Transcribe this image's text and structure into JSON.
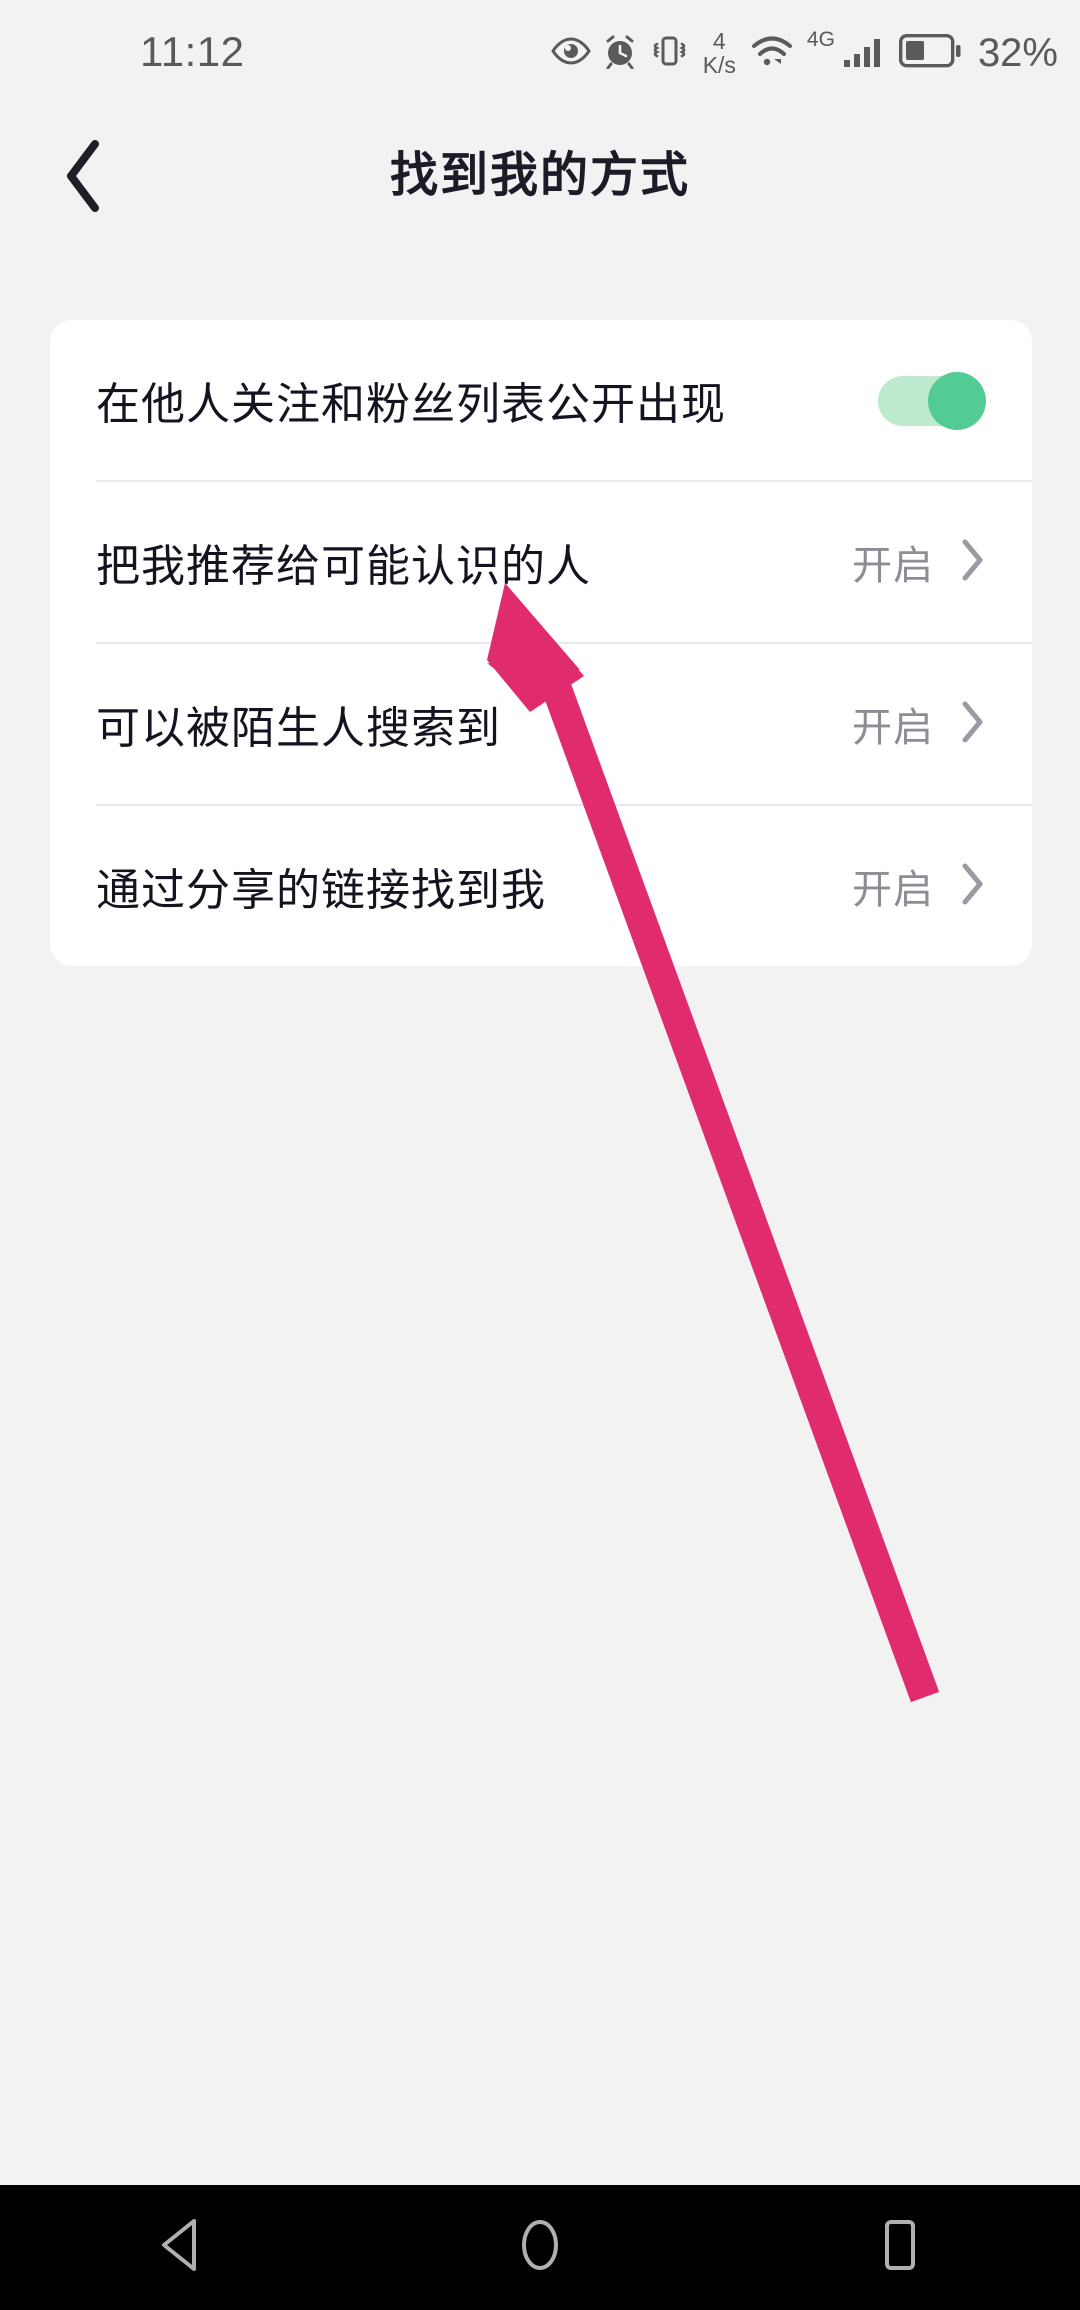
{
  "statusbar": {
    "time": "11:12",
    "network_speed_value": "4",
    "network_speed_unit": "K/s",
    "signal_gen": "4G",
    "battery_percent": "32%",
    "icons": [
      "eye-care-icon",
      "alarm-clock-icon",
      "vibrate-icon",
      "wifi-icon",
      "cellular-signal-icon",
      "battery-icon"
    ]
  },
  "header": {
    "title": "找到我的方式",
    "back_icon": "chevron-left-icon"
  },
  "settings": {
    "rows": [
      {
        "label": "在他人关注和粉丝列表公开出现",
        "control": "toggle",
        "toggle_on": true
      },
      {
        "label": "把我推荐给可能认识的人",
        "control": "value-chevron",
        "value": "开启"
      },
      {
        "label": "可以被陌生人搜索到",
        "control": "value-chevron",
        "value": "开启"
      },
      {
        "label": "通过分享的链接找到我",
        "control": "value-chevron",
        "value": "开启"
      }
    ]
  },
  "annotation": {
    "type": "arrow",
    "color": "#e02b6e",
    "points_to_row_index": 1
  },
  "navbar": {
    "back_label": "back-triangle-icon",
    "home_label": "home-circle-icon",
    "recents_label": "recents-square-icon"
  },
  "colors": {
    "background": "#f2f2f2",
    "card": "#ffffff",
    "primary_text": "#141420",
    "secondary_text": "#8d8d95",
    "toggle_on_track": "#bdeacf",
    "toggle_on_knob": "#52cc94",
    "annotation_pink": "#e02b6e",
    "navbar": "#000000"
  }
}
